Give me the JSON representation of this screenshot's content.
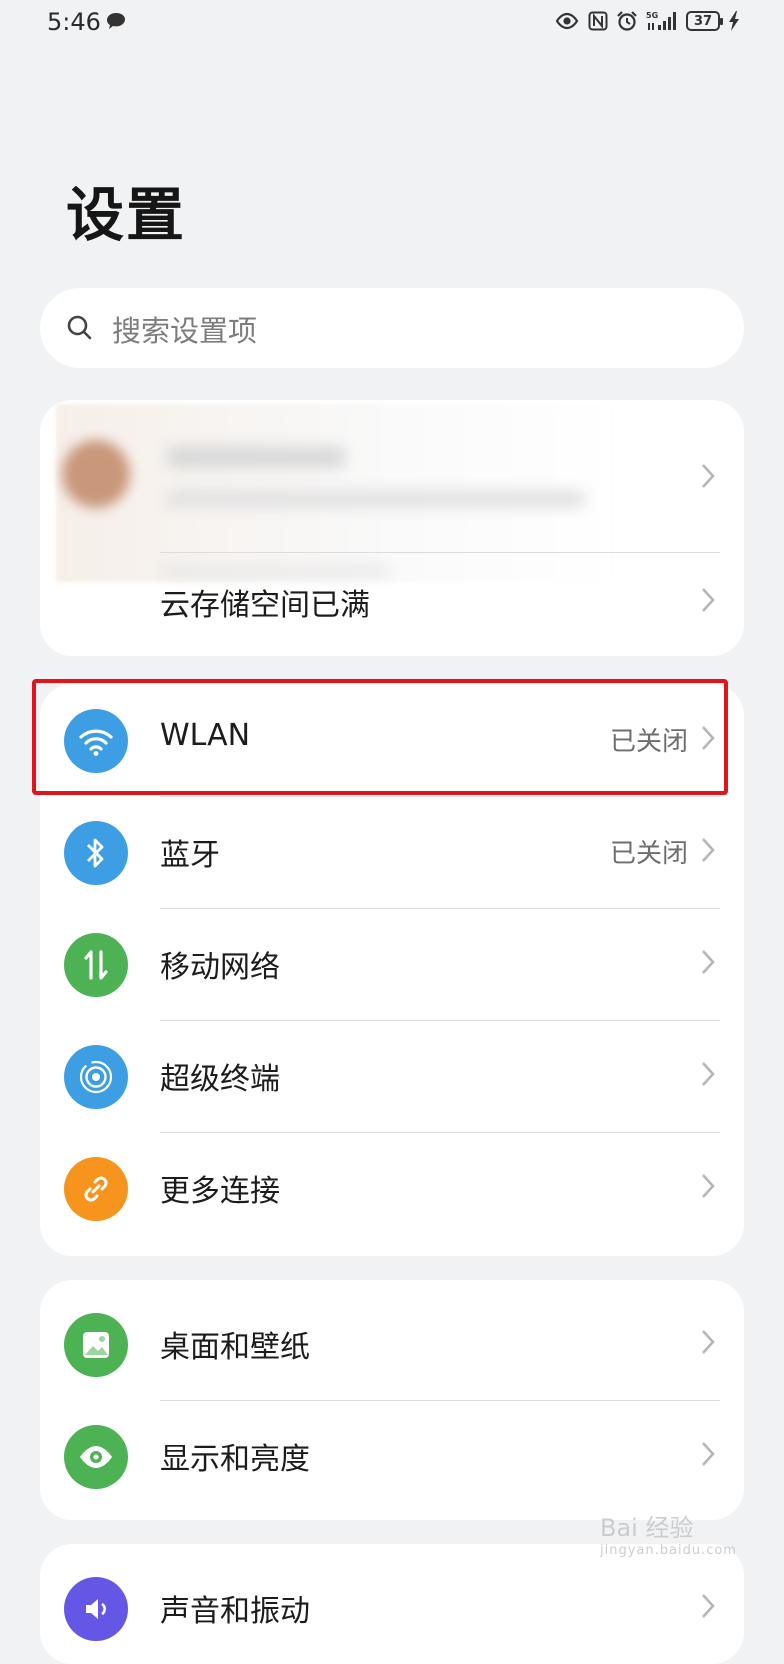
{
  "status_bar": {
    "time": "5:46",
    "battery": "37",
    "network": "5G",
    "icons": [
      "chat-bubble-icon",
      "eye-icon",
      "nfc-icon",
      "alarm-icon",
      "signal-icon",
      "battery-icon",
      "charging-icon"
    ]
  },
  "page": {
    "title": "设置"
  },
  "search": {
    "placeholder": "搜索设置项"
  },
  "account": {
    "storage_label": "云存储空间已满"
  },
  "connect_items": [
    {
      "label": "WLAN",
      "value": "已关闭",
      "icon": "wifi-icon",
      "color": "#3d9ee4"
    },
    {
      "label": "蓝牙",
      "value": "已关闭",
      "icon": "bluetooth-icon",
      "color": "#3d9ee4"
    },
    {
      "label": "移动网络",
      "value": "",
      "icon": "mobile-data-icon",
      "color": "#4cb254"
    },
    {
      "label": "超级终端",
      "value": "",
      "icon": "super-device-icon",
      "color": "#3d9ee4"
    },
    {
      "label": "更多连接",
      "value": "",
      "icon": "link-icon",
      "color": "#f7941d"
    }
  ],
  "display_items": [
    {
      "label": "桌面和壁纸",
      "icon": "wallpaper-icon",
      "color": "#4cb254"
    },
    {
      "label": "显示和亮度",
      "icon": "display-eye-icon",
      "color": "#4cb254"
    }
  ],
  "partial_item": {
    "label": "声音和振动",
    "icon": "sound-icon",
    "color": "#6457e6"
  },
  "highlight_color": "#e0141c",
  "watermark": {
    "text": "Bai 经验",
    "sub": "jingyan.baidu.com"
  }
}
